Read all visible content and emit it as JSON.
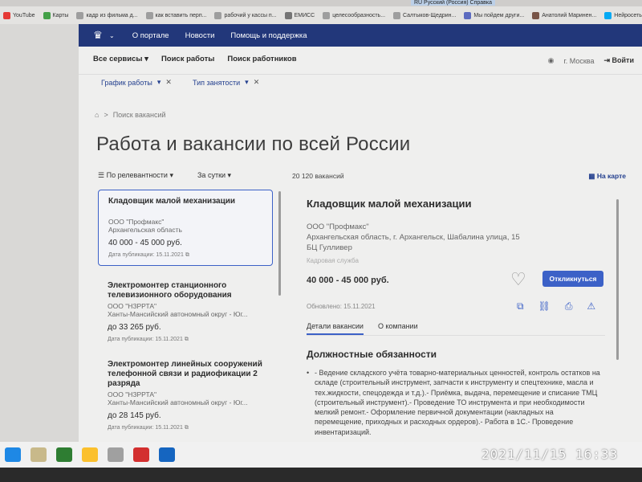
{
  "browser": {
    "lang_label": "RU Русский (Россия) Справка",
    "bookmarks": [
      {
        "label": "YouTube",
        "color": "#e53935"
      },
      {
        "label": "Карты",
        "color": "#43a047"
      },
      {
        "label": "кадр из фильма д...",
        "color": "#9e9e9e"
      },
      {
        "label": "как вставить перп...",
        "color": "#9e9e9e"
      },
      {
        "label": "рабочий у кассы п...",
        "color": "#9e9e9e"
      },
      {
        "label": "ЕМИСС",
        "color": "#757575"
      },
      {
        "label": "целесообразность...",
        "color": "#9e9e9e"
      },
      {
        "label": "Салтыков-Щедрин...",
        "color": "#9e9e9e"
      },
      {
        "label": "Мы пойдем други...",
        "color": "#5c6bc0"
      },
      {
        "label": "Анатолий Маринен...",
        "color": "#795548"
      },
      {
        "label": "Нейросеть",
        "color": "#03a9f4"
      }
    ]
  },
  "nav": {
    "links": [
      "О портале",
      "Новости",
      "Помощь и поддержка"
    ]
  },
  "subnav": {
    "items": [
      "Все сервисы",
      "Поиск работы",
      "Поиск работников"
    ],
    "city": "г. Москва",
    "login": "Войти"
  },
  "filters": {
    "chips": [
      "График работы",
      "Тип занятости"
    ]
  },
  "breadcrumb": {
    "current": "Поиск вакансий"
  },
  "page_title": "Работа и вакансии по всей России",
  "sort": {
    "order": "По релевантности",
    "period": "За сутки"
  },
  "results_count": "20 120 вакансий",
  "map_link": "На карте",
  "vacancies": [
    {
      "title": "Кладовщик малой механизации",
      "org": "ООО \"Профмакс\"",
      "region": "Архангельская область",
      "salary": "40 000 - 45 000 руб.",
      "date": "Дата публикации: 15.11.2021"
    },
    {
      "title": "Электромонтер станционного телевизионного оборудования",
      "org": "ООО \"НЗРРТА\"",
      "region": "Ханты-Мансийский автономный округ - Юг...",
      "salary": "до 33 265 руб.",
      "date": "Дата публикации: 15.11.2021"
    },
    {
      "title": "Электромонтер линейных сооружений телефонной связи и радиофикации 2 разряда",
      "org": "ООО \"НЗРРТА\"",
      "region": "Ханты-Мансийский автономный округ - Юг...",
      "salary": "до 28 145 руб.",
      "date": "Дата публикации: 15.11.2021"
    }
  ],
  "detail": {
    "title": "Кладовщик малой механизации",
    "org": "ООО \"Профмакс\"",
    "address_line1": "Архангельская область, г. Архангельск, Шабалина улица, 15",
    "address_line2": "БЦ Гулливер",
    "hr_label": "Кадровая служба",
    "salary": "40 000 - 45 000 руб.",
    "apply_label": "Откликнуться",
    "updated": "Обновлено: 15.11.2021",
    "tab_details": "Детали вакансии",
    "tab_company": "О компании",
    "section_title": "Должностные обязанности",
    "duties": "- Ведение складского учёта товарно-материальных ценностей, контроль остатков на складе (строительный инструмент, запчасти к инструменту и спецтехнике, масла и тех.жидкости, спецодежда и т.д.).- Приёмка, выдача, перемещение и списание ТМЦ (строительный инструмент).- Проведение ТО инструмента и при необходимости мелкий ремонт.- Оформление первичной документации (накладных на перемещение, приходных и расходных ордеров).- Работа в 1С.- Проведение инвентаризаций."
  },
  "camera_timestamp": "2021/11/15  16:33",
  "colors": {
    "accent": "#3c61c7",
    "nav_bg": "#22377a"
  }
}
